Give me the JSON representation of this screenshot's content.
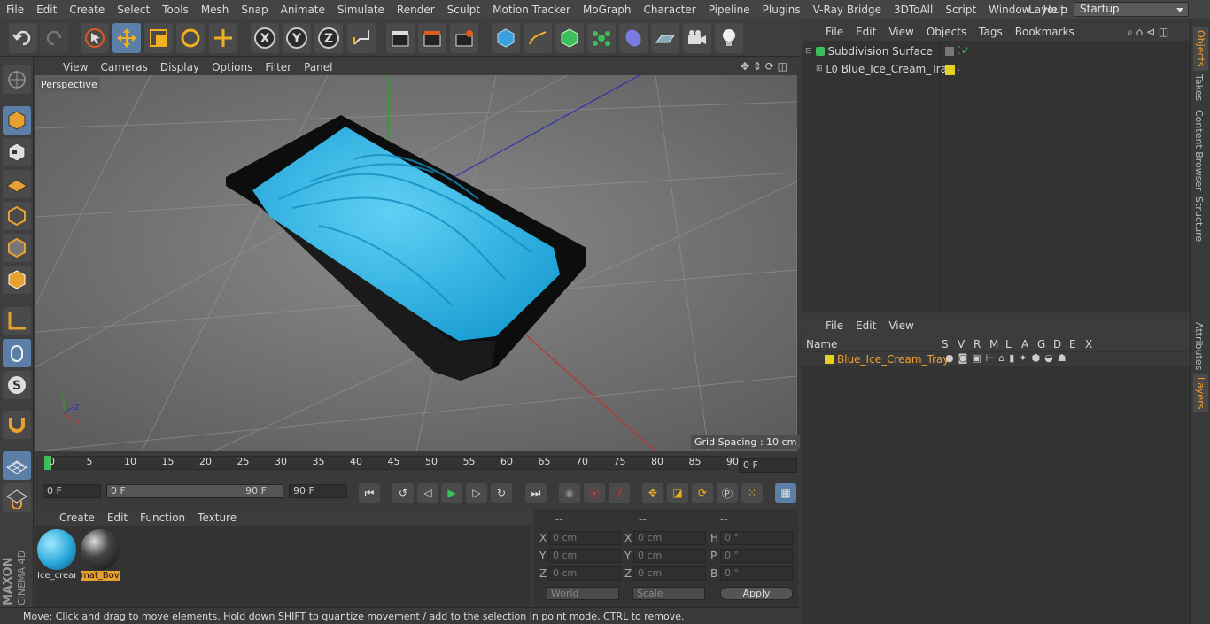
{
  "menubar": {
    "items": [
      "File",
      "Edit",
      "Create",
      "Select",
      "Tools",
      "Mesh",
      "Snap",
      "Animate",
      "Simulate",
      "Render",
      "Sculpt",
      "Motion Tracker",
      "MoGraph",
      "Character",
      "Pipeline",
      "Plugins",
      "V-Ray Bridge",
      "3DToAll",
      "Script",
      "Window",
      "Help"
    ],
    "layout_label": "Layout:",
    "layout_value": "Startup"
  },
  "viewport": {
    "menu": [
      "View",
      "Cameras",
      "Display",
      "Options",
      "Filter",
      "Panel"
    ],
    "label": "Perspective",
    "grid_spacing": "Grid Spacing : 10 cm"
  },
  "timeline": {
    "ticks": [
      "0",
      "5",
      "10",
      "15",
      "20",
      "25",
      "30",
      "35",
      "40",
      "45",
      "50",
      "55",
      "60",
      "65",
      "70",
      "75",
      "80",
      "85",
      "90"
    ],
    "current_frame": "0 F"
  },
  "transport": {
    "start": "0 F",
    "range_start": "0 F",
    "range_end": "90 F",
    "end": "90 F"
  },
  "materials": {
    "menu": [
      "Create",
      "Edit",
      "Function",
      "Texture"
    ],
    "items": [
      {
        "label": "Ice_crear",
        "color": "#2aa6d8"
      },
      {
        "label": "mat_Bov",
        "color": "#1a1a1a"
      }
    ]
  },
  "coords": {
    "headers": [
      "--",
      "--",
      "--"
    ],
    "rows": [
      {
        "a": "X",
        "av": "0 cm",
        "b": "X",
        "bv": "0 cm",
        "c": "H",
        "cv": "0 °"
      },
      {
        "a": "Y",
        "av": "0 cm",
        "b": "Y",
        "bv": "0 cm",
        "c": "P",
        "cv": "0 °"
      },
      {
        "a": "Z",
        "av": "0 cm",
        "b": "Z",
        "bv": "0 cm",
        "c": "B",
        "cv": "0 °"
      }
    ],
    "mode1": "World",
    "mode2": "Scale",
    "apply": "Apply"
  },
  "objects": {
    "menu": [
      "File",
      "Edit",
      "View",
      "Objects",
      "Tags",
      "Bookmarks"
    ],
    "items": [
      "Subdivision Surface",
      "Blue_Ice_Cream_Tray"
    ]
  },
  "layers": {
    "menu": [
      "File",
      "Edit",
      "View"
    ],
    "name_col": "Name",
    "flags": [
      "S",
      "V",
      "R",
      "M",
      "L",
      "A",
      "G",
      "D",
      "E",
      "X"
    ],
    "item": "Blue_Ice_Cream_Tray",
    "item_color": "#e8d020"
  },
  "sidetabs": [
    "Objects",
    "Takes",
    "Content Browser",
    "Structure",
    "Attributes",
    "Layers"
  ],
  "status": "Move: Click and drag to move elements. Hold down SHIFT to quantize movement / add to the selection in point mode, CTRL to remove.",
  "brand": {
    "maxon": "MAXON",
    "cinema": "CINEMA 4D"
  }
}
